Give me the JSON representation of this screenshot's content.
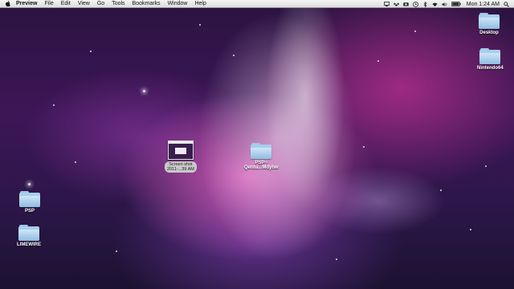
{
  "menubar": {
    "app_name": "Preview",
    "items": [
      "File",
      "Edit",
      "View",
      "Go",
      "Tools",
      "Bookmarks",
      "Window",
      "Help"
    ],
    "clock": "Mon 1:24 AM"
  },
  "desktop_icons": {
    "desktop": "Desktop",
    "nintendo64": "Nintendo64",
    "screenshot_line1": "Screen shot",
    "screenshot_line2": "2011-...39 AM",
    "psp_folder_line1": "PSP--",
    "psp_folder_line2": "Qehtu...Mdyhw",
    "psp": "PSP",
    "limewire": "LIMEWIRE"
  }
}
